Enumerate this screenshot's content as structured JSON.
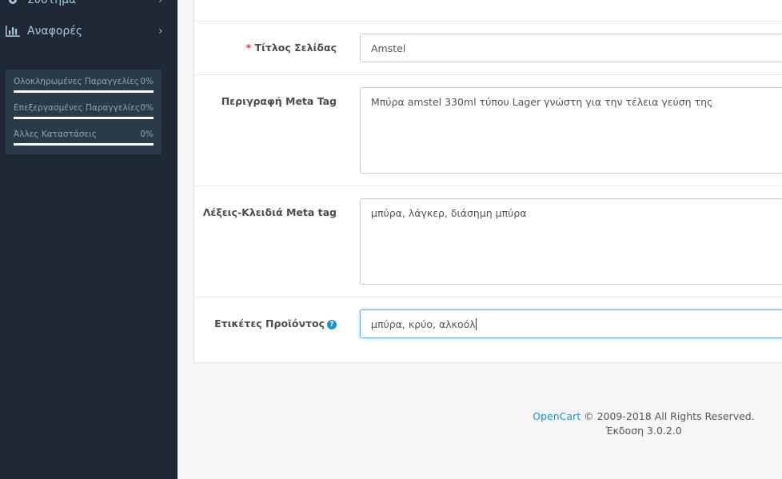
{
  "sidebar": {
    "items": [
      {
        "label": "Σύστημα",
        "icon": "gear-icon"
      },
      {
        "label": "Αναφορές",
        "icon": "bar-chart-icon"
      }
    ],
    "stats": [
      {
        "label": "Ολοκληρωμένες Παραγγελίες",
        "percent": "0%"
      },
      {
        "label": "Επεξεργασμένες Παραγγελίες",
        "percent": "0%"
      },
      {
        "label": "Άλλες Καταστάσεις",
        "percent": "0%"
      }
    ]
  },
  "form": {
    "page_title": {
      "label": "Τίτλος Σελίδας",
      "required_mark": "*",
      "value": "Amstel"
    },
    "meta_description": {
      "label": "Περιγραφή Meta Tag",
      "value": "Μπύρα amstel 330ml τύπου Lager γνώστη για την τέλεια γεύση της"
    },
    "meta_keywords": {
      "label": "Λέξεις-Κλειδιά Meta tag",
      "value": "μπύρα, λάγκερ, διάσημη μπύρα"
    },
    "product_tags": {
      "label": "Ετικέτες Προϊόντος",
      "help": "?",
      "value": "μπύρα, κρύο, αλκοόλ"
    }
  },
  "footer": {
    "brand": "OpenCart",
    "copyright": "© 2009-2018 All Rights Reserved.",
    "version": "Έκδοση 3.0.2.0"
  },
  "colors": {
    "sidebar_bg": "#1f2935",
    "link": "#1e91cf",
    "required": "#e3323b"
  }
}
